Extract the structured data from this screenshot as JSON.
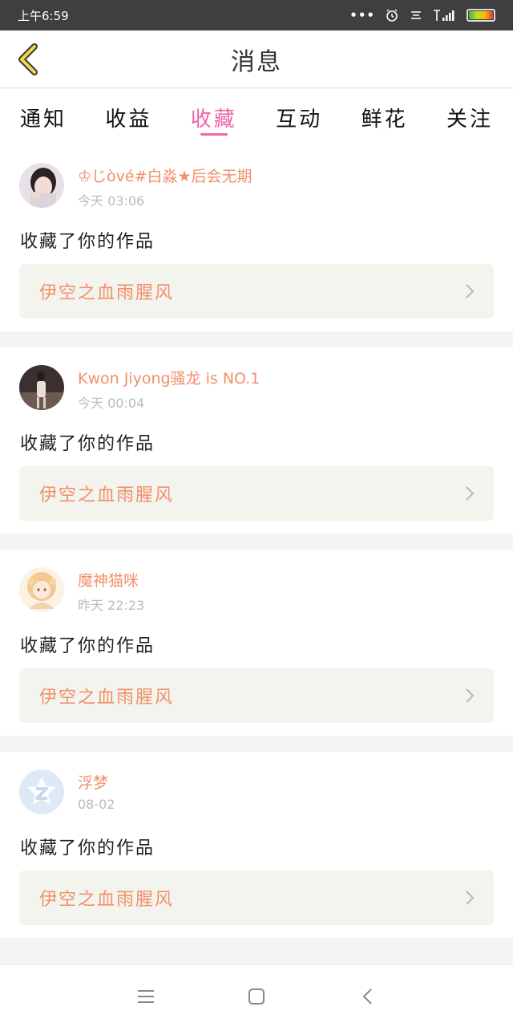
{
  "status_bar": {
    "time": "上午6:59",
    "dots": "•••"
  },
  "header": {
    "title": "消息"
  },
  "tabs": [
    {
      "label": "通知"
    },
    {
      "label": "收益"
    },
    {
      "label": "收藏"
    },
    {
      "label": "互动"
    },
    {
      "label": "鲜花"
    },
    {
      "label": "关注"
    }
  ],
  "active_tab": "收藏",
  "colors": {
    "accent_pink": "#ee66a8",
    "username_orange": "#f0906a",
    "link_bg": "#f4f4ee"
  },
  "notifications": [
    {
      "username": "♔じòvé#白淼★后会无期",
      "time": "今天 03:06",
      "message": "收藏了你的作品",
      "work_title": "伊空之血雨腥风",
      "avatar": "girl-photo-avatar"
    },
    {
      "username": "Kwon Jiyong骚龙 is NO.1",
      "time": "今天 00:04",
      "message": "收藏了你的作品",
      "work_title": "伊空之血雨腥风",
      "avatar": "fashion-photo-avatar"
    },
    {
      "username": "魔神猫咪",
      "time": "昨天 22:23",
      "message": "收藏了你的作品",
      "work_title": "伊空之血雨腥风",
      "avatar": "anime-girl-avatar"
    },
    {
      "username": "浮梦",
      "time": "08-02",
      "message": "收藏了你的作品",
      "work_title": "伊空之血雨腥风",
      "avatar": "default-qzone-avatar"
    }
  ]
}
